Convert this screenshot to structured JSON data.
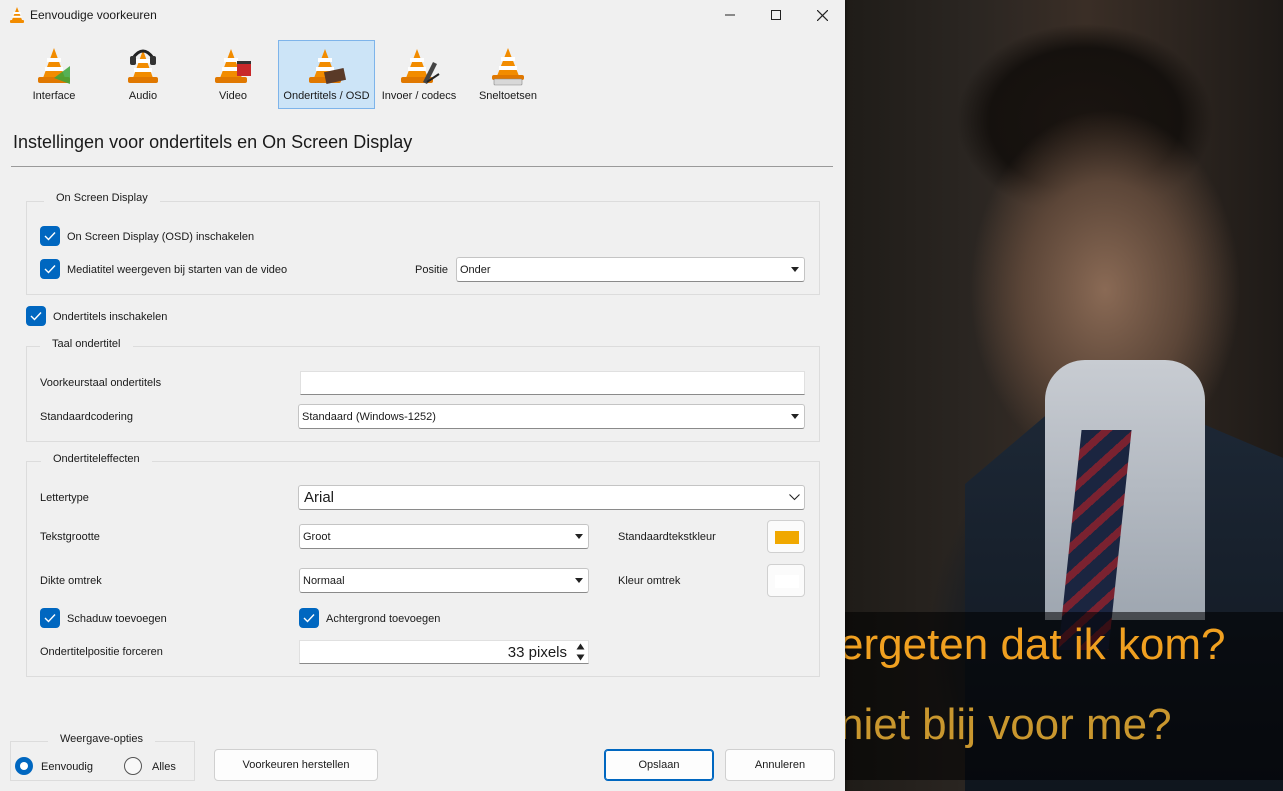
{
  "window": {
    "title": "Eenvoudige voorkeuren",
    "minimize_icon": "minimize-icon",
    "maximize_icon": "maximize-icon",
    "close_icon": "close-icon"
  },
  "categories": [
    {
      "label": "Interface",
      "icon": "vlc-interface-icon",
      "active": false
    },
    {
      "label": "Audio",
      "icon": "vlc-audio-icon",
      "active": false
    },
    {
      "label": "Video",
      "icon": "vlc-video-icon",
      "active": false
    },
    {
      "label": "Ondertitels / OSD",
      "icon": "vlc-subtitles-icon",
      "active": true
    },
    {
      "label": "Invoer / codecs",
      "icon": "vlc-input-codecs-icon",
      "active": false
    },
    {
      "label": "Sneltoetsen",
      "icon": "vlc-hotkeys-icon",
      "active": false
    }
  ],
  "heading": "Instellingen voor ondertitels en On Screen Display",
  "osd": {
    "group_title": "On Screen Display",
    "enable_osd_label": "On Screen Display (OSD) inschakelen",
    "enable_osd_checked": true,
    "show_title_label": "Mediatitel weergeven bij starten van de video",
    "show_title_checked": true,
    "position_label": "Positie",
    "position_value": "Onder"
  },
  "subtitles": {
    "enable_label": "Ondertitels inschakelen",
    "enable_checked": true
  },
  "language": {
    "group_title": "Taal ondertitel",
    "preferred_label": "Voorkeurstaal ondertitels",
    "preferred_value": "",
    "encoding_label": "Standaardcodering",
    "encoding_value": "Standaard (Windows-1252)"
  },
  "effects": {
    "group_title": "Ondertiteleffecten",
    "font_label": "Lettertype",
    "font_value": "Arial",
    "size_label": "Tekstgrootte",
    "size_value": "Groot",
    "text_color_label": "Standaardtekstkleur",
    "text_color": "#f0a800",
    "outline_label": "Dikte omtrek",
    "outline_value": "Normaal",
    "outline_color_label": "Kleur omtrek",
    "outline_color": "#ffffff",
    "shadow_label": "Schaduw toevoegen",
    "shadow_checked": true,
    "background_label": "Achtergrond toevoegen",
    "background_checked": true,
    "force_position_label": "Ondertitelpositie forceren",
    "force_position_value": "33 pixels"
  },
  "view": {
    "group_title": "Weergave-opties",
    "simple_label": "Eenvoudig",
    "simple_selected": true,
    "all_label": "Alles",
    "all_selected": false
  },
  "buttons": {
    "reset": "Voorkeuren herstellen",
    "save": "Opslaan",
    "cancel": "Annuleren"
  },
  "video_subtitles": {
    "line1": "ergeten dat ik kom?",
    "line2": "niet blij voor me?"
  },
  "colors": {
    "accent": "#0067c0",
    "active_tab": "#cce4f7"
  }
}
